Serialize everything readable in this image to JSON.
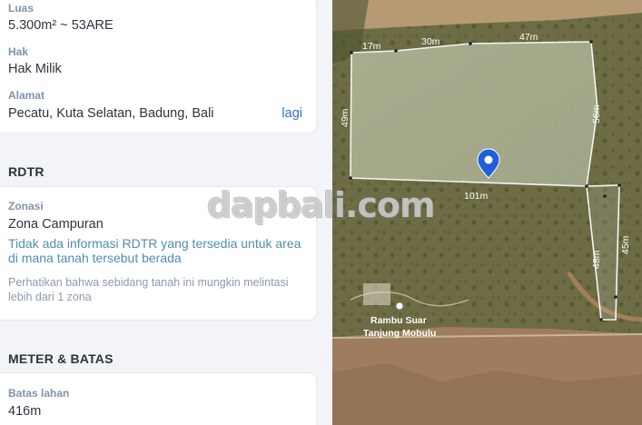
{
  "property": {
    "luas_label": "Luas",
    "luas_value": "5.300m² ~ 53ARE",
    "hak_label": "Hak",
    "hak_value": "Hak Milik",
    "alamat_label": "Alamat",
    "alamat_value": "Pecatu, Kuta Selatan, Badung, Bali",
    "alamat_more": "lagi"
  },
  "rdtr": {
    "heading": "RDTR",
    "zonasi_label": "Zonasi",
    "zonasi_value": "Zona Campuran",
    "info_text": "Tidak ada informasi RDTR yang tersedia untuk area di mana tanah tersebut berada",
    "note_text": "Perhatikan bahwa sebidang tanah ini mungkin melintasi lebih dari 1 zona"
  },
  "meter": {
    "heading": "METER & BATAS",
    "batas_label": "Batas lahan",
    "batas_value": "416m"
  },
  "map": {
    "dimensions": {
      "top_a": "17m",
      "top_b": "30m",
      "top_c": "47m",
      "left": "49m",
      "right_upper": "56m",
      "bottom": "101m",
      "right_lower_a": "48m",
      "right_lower_b": "45m"
    },
    "place_line1": "Rambu Suar",
    "place_line2": "Tanjung Mobulu",
    "pin_color": "#1f5fd8"
  },
  "watermark": "dapbali.com"
}
